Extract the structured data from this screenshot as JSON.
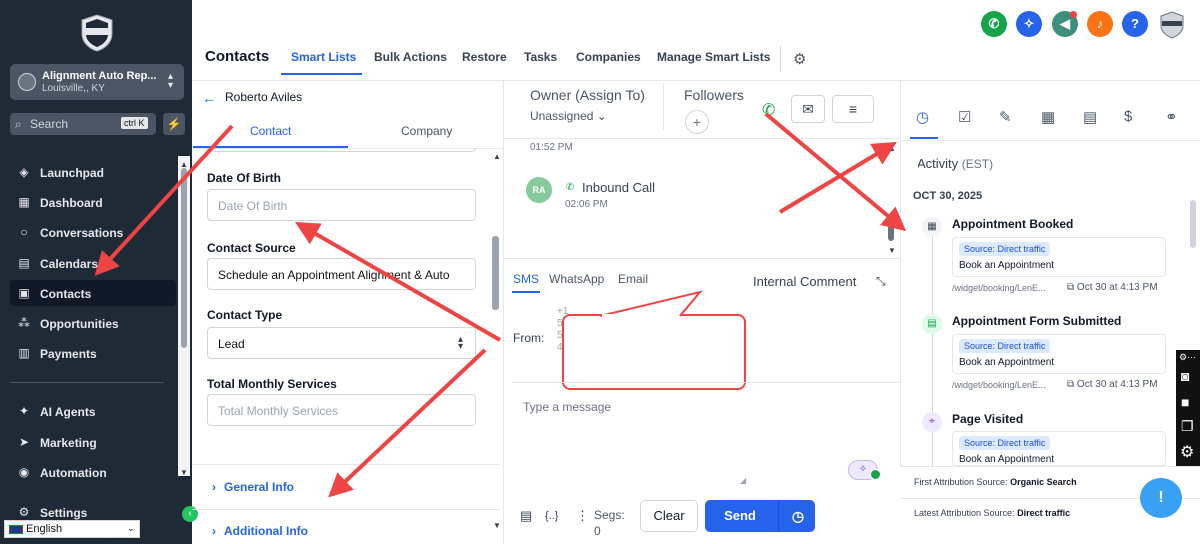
{
  "sidebar": {
    "account": {
      "name": "Alignment Auto Rep...",
      "location": "Louisville,, KY"
    },
    "search": {
      "placeholder": "Search",
      "shortcut": "ctrl K"
    },
    "items": [
      {
        "label": "Launchpad",
        "icon": "rocket-icon"
      },
      {
        "label": "Dashboard",
        "icon": "grid-icon"
      },
      {
        "label": "Conversations",
        "icon": "chat-icon"
      },
      {
        "label": "Calendars",
        "icon": "calendar-icon"
      },
      {
        "label": "Contacts",
        "icon": "contacts-icon",
        "active": true
      },
      {
        "label": "Opportunities",
        "icon": "opportunities-icon"
      },
      {
        "label": "Payments",
        "icon": "payments-icon"
      },
      {
        "label": "AI Agents",
        "icon": "sparkle-icon"
      },
      {
        "label": "Marketing",
        "icon": "send-icon"
      },
      {
        "label": "Automation",
        "icon": "automation-icon"
      },
      {
        "label": "Settings",
        "icon": "gear-icon"
      }
    ],
    "language": "English"
  },
  "header": {
    "title": "Contacts",
    "tabs": [
      "Smart Lists",
      "Bulk Actions",
      "Restore",
      "Tasks",
      "Companies",
      "Manage Smart Lists"
    ],
    "active_tab": "Smart Lists"
  },
  "contact": {
    "name": "Roberto Aviles",
    "tabs": [
      "Contact",
      "Company"
    ],
    "fields": {
      "dob_label": "Date Of Birth",
      "dob_placeholder": "Date Of Birth",
      "source_label": "Contact Source",
      "source_value": "Schedule an Appointment Alignment & Auto",
      "type_label": "Contact Type",
      "type_value": "Lead",
      "services_label": "Total Monthly Services",
      "services_placeholder": "Total Monthly Services"
    },
    "sections": [
      "General Info",
      "Additional Info"
    ]
  },
  "conversation": {
    "owner_label": "Owner (Assign To)",
    "owner_value": "Unassigned",
    "followers_label": "Followers",
    "time1": "01:52 PM",
    "initials": "RA",
    "event": "Inbound Call",
    "time2": "02:06 PM",
    "channels": [
      "SMS",
      "WhatsApp",
      "Email"
    ],
    "internal_comment": "Internal Comment",
    "from_label": "From:",
    "from_partial": [
      "+1",
      "5",
      "5",
      "4"
    ],
    "message_placeholder": "Type a message",
    "segs": "Segs:",
    "segs_count": "0",
    "clear_label": "Clear",
    "send_label": "Send"
  },
  "activity": {
    "title": "Activity",
    "timezone": "(EST)",
    "title_prefix": "A",
    "date": "OCT 30, 2025",
    "events": [
      {
        "title": "Appointment Booked",
        "source": "Source: Direct traffic",
        "text": "Book an Appointment",
        "url": "/widget/booking/LenE...",
        "when": "Oct 30 at 4:13 PM"
      },
      {
        "title": "Appointment Form Submitted",
        "source": "Source: Direct traffic",
        "text": "Book an Appointment",
        "url": "/widget/booking/LenE...",
        "when": "Oct 30 at 4:13 PM"
      },
      {
        "title": "Page Visited",
        "source": "Source: Direct traffic",
        "text": "Book an Appointment",
        "url": "",
        "when": ""
      }
    ],
    "first_attribution_label": "First Attribution Source:",
    "first_attribution_value": "Organic Search",
    "latest_attribution_label": "Latest Attribution Source:",
    "latest_attribution_value": "Direct traffic"
  },
  "colors": {
    "accent": "#2563eb",
    "sidebar": "#1f2a37",
    "annotation": "#ef4444"
  }
}
